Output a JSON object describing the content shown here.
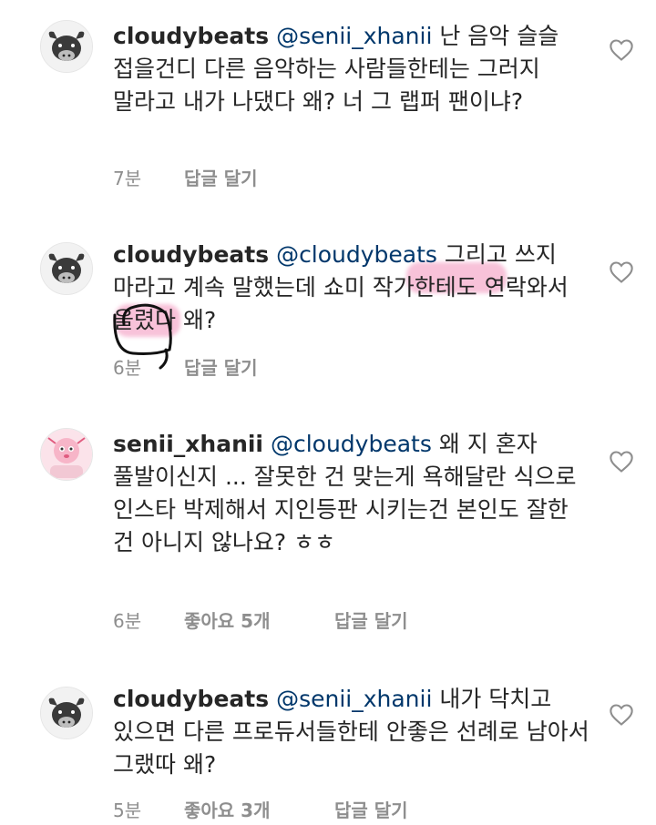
{
  "comments": [
    {
      "username": "cloudybeats",
      "mention": "@senii_xhanii",
      "text": "난 음악 슬슬 접을건디 다른 음악하는 사람들한테는 그러지 말라고 내가 나댔다 왜? 너 그 랩퍼 팬이냐?",
      "time": "7분",
      "likes": "",
      "reply": "답글 달기",
      "avatar_icon": "bull-avatar-icon"
    },
    {
      "username": "cloudybeats",
      "mention": "@cloudybeats",
      "text": "그리고 쓰지 마라고 계속 말했는데 쇼미 작가한테도 연락와서 올렸다 왜?",
      "time": "6분",
      "likes": "",
      "reply": "답글 달기",
      "avatar_icon": "bull-avatar-icon"
    },
    {
      "username": "senii_xhanii",
      "mention": "@cloudybeats",
      "text": "왜 지 혼자 풀발이신지 ... 잘못한 건 맞는게 욕해달란 식으로 인스타 박제해서 지인등판 시키는건 본인도 잘한 건 아니지 않나요? ㅎㅎ",
      "time": "6분",
      "likes": "좋아요 5개",
      "reply": "답글 달기",
      "avatar_icon": "pink-character-avatar-icon"
    },
    {
      "username": "cloudybeats",
      "mention": "@senii_xhanii",
      "text": "내가 닥치고 있으면 다른 프로듀서들한테 안좋은 선례로 남아서 그랬따 왜?",
      "time": "5분",
      "likes": "좋아요 3개",
      "reply": "답글 달기",
      "avatar_icon": "bull-avatar-icon"
    }
  ],
  "icons": {
    "like": "heart-outline-icon"
  },
  "colors": {
    "mention": "#00376b",
    "meta": "#8e8e8e",
    "highlight": "#f078aa"
  }
}
